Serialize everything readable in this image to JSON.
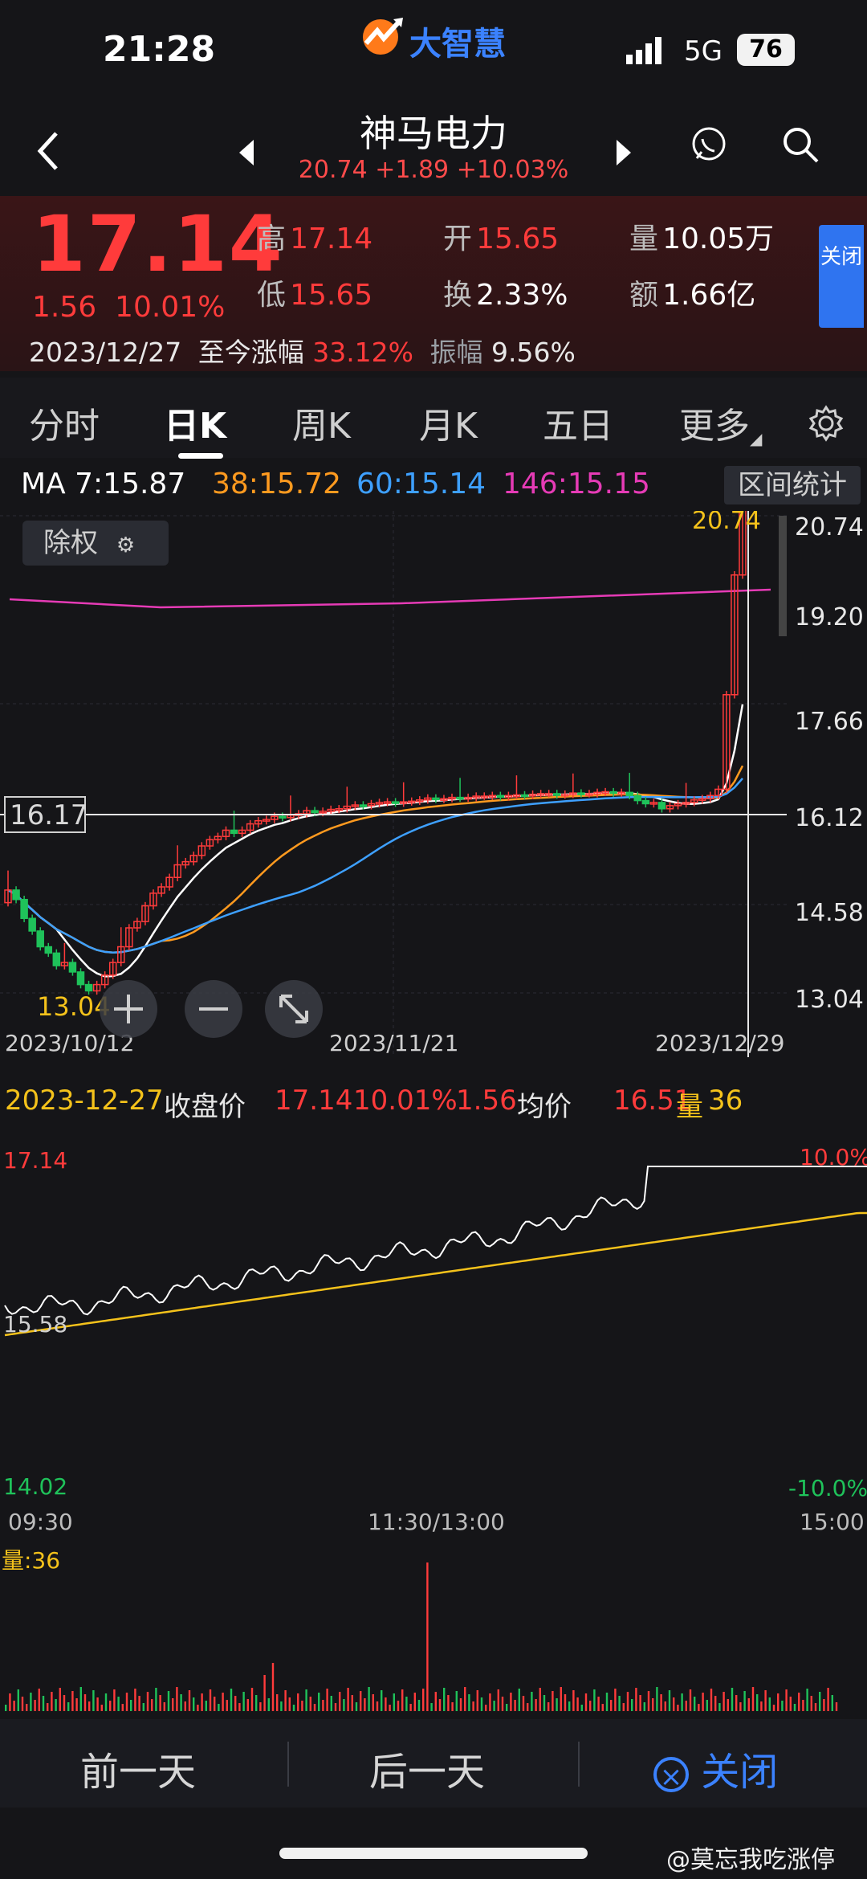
{
  "status": {
    "time": "21:28",
    "network": "5G",
    "battery": "76",
    "logo_text": "大智慧"
  },
  "header": {
    "name": "神马电力",
    "sub_price": "20.74",
    "sub_change": "+1.89",
    "sub_pct": "+10.03%"
  },
  "quote": {
    "price": "17.14",
    "change": "1.56",
    "change_pct": "10.01%",
    "date": "2023/12/27",
    "since_label": "至今涨幅",
    "since_value": "33.12%",
    "amp_label": "振幅",
    "amp_value": "9.56%",
    "high_label": "高",
    "high": "17.14",
    "open_label": "开",
    "open": "15.65",
    "vol_label": "量",
    "vol": "10.05万",
    "low_label": "低",
    "low": "15.65",
    "turn_label": "换",
    "turn": "2.33%",
    "amt_label": "额",
    "amt": "1.66亿",
    "close_btn": "关闭"
  },
  "tabs": [
    {
      "label": "分时"
    },
    {
      "label": "日K"
    },
    {
      "label": "周K"
    },
    {
      "label": "月K"
    },
    {
      "label": "五日"
    },
    {
      "label": "更多"
    }
  ],
  "ma": {
    "ma7": "MA 7:15.87",
    "ma38": "38:15.72",
    "ma60": "60:15.14",
    "ma146": "146:15.15",
    "range_stat": "区间统计"
  },
  "kline": {
    "exright_label": "除权",
    "y_ticks": [
      "20.74",
      "19.20",
      "17.66",
      "16.12",
      "14.58",
      "13.04"
    ],
    "cursor_price_top": "20.74",
    "crosshair_label": "16.17",
    "low_label": "13.04",
    "x_ticks": [
      "2023/10/12",
      "2023/11/21",
      "2023/12/29"
    ]
  },
  "intraday": {
    "date": "2023-12-27",
    "close_label": "收盘价",
    "close": "17.14",
    "pct": "10.01%",
    "chg": "1.56",
    "avg_label": "均价",
    "avg": "16.51",
    "vol_label": "量",
    "vol": "36",
    "top_price": "17.14",
    "top_pct": "10.0%",
    "mid_price": "15.58",
    "bottom_price": "14.02",
    "bottom_pct": "-10.0%",
    "times": [
      "09:30",
      "11:30/13:00",
      "15:00"
    ],
    "volume_label": "量:36"
  },
  "bottom_nav": {
    "prev": "前一天",
    "next": "后一天",
    "close": "关闭"
  },
  "watermark": "@莫忘我吃涨停",
  "colors": {
    "up": "#ff3b3b",
    "down": "#1fc25a",
    "ma7": "#ffffff",
    "ma38": "#ff9a1f",
    "ma60": "#3ea0ff",
    "ma146": "#e63bb6",
    "accent": "#2f74f0"
  }
}
